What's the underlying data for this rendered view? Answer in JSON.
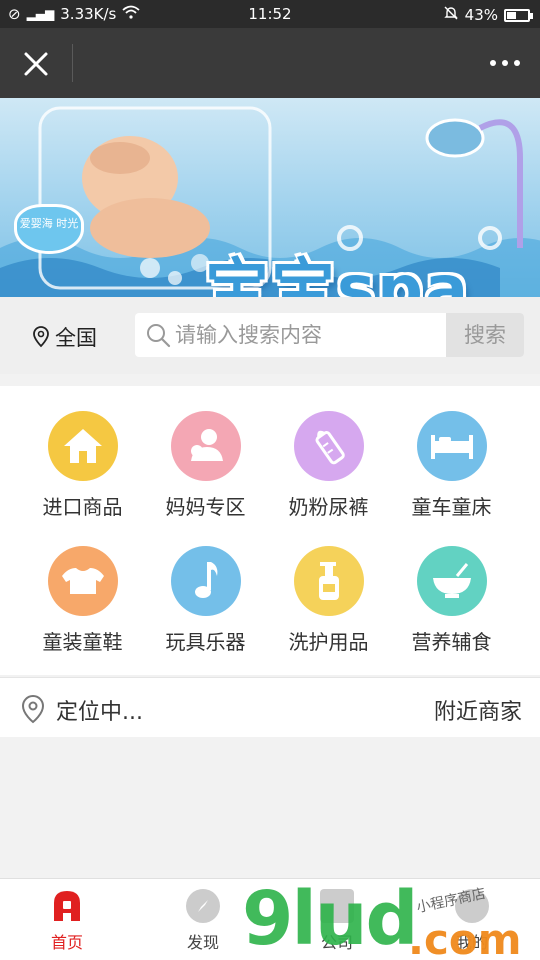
{
  "status_bar": {
    "network_speed": "3.33K/s",
    "time": "11:52",
    "battery": "43%",
    "battery_level": 0.43
  },
  "title_bar": {
    "close_icon": "close-icon",
    "more_icon": "more-dots-icon"
  },
  "banner": {
    "title": "宝宝spa",
    "logo_text": "爱婴海 时光",
    "active_slide": 1
  },
  "search": {
    "location_label": "全国",
    "placeholder": "请输入搜索内容",
    "button_label": "搜索"
  },
  "categories": [
    {
      "label": "进口商品",
      "icon": "house-icon",
      "color": "#f5c842"
    },
    {
      "label": "妈妈专区",
      "icon": "mother-icon",
      "color": "#f4a7b4"
    },
    {
      "label": "奶粉尿裤",
      "icon": "baby-bottle-icon",
      "color": "#d6a8ef"
    },
    {
      "label": "童车童床",
      "icon": "crib-icon",
      "color": "#74bfe9"
    },
    {
      "label": "童装童鞋",
      "icon": "clothes-icon",
      "color": "#f7a86a"
    },
    {
      "label": "玩具乐器",
      "icon": "music-note-icon",
      "color": "#74bfe9"
    },
    {
      "label": "洗护用品",
      "icon": "lotion-bottle-icon",
      "color": "#f5d25a"
    },
    {
      "label": "营养辅食",
      "icon": "food-bowl-icon",
      "color": "#62d2c2"
    }
  ],
  "location_row": {
    "status": "定位中...",
    "nearby": "附近商家"
  },
  "tabbar": [
    {
      "label": "首页",
      "icon": "home-icon",
      "active": true
    },
    {
      "label": "发现",
      "icon": "compass-icon",
      "active": false
    },
    {
      "label": "公司",
      "icon": "company-icon",
      "active": false
    },
    {
      "label": "我的",
      "icon": "user-icon",
      "active": false
    }
  ],
  "watermark": {
    "main": "9lud",
    "suffix": ".com",
    "tagline": "小程序商店"
  },
  "colors": {
    "accent_red": "#e02020",
    "title_bar": "#3a3a3a"
  }
}
